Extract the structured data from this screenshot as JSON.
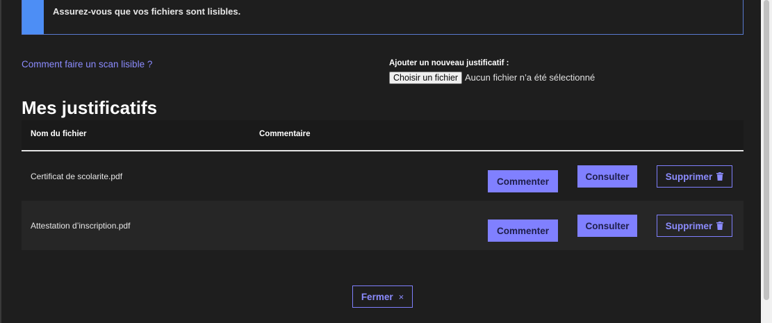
{
  "notice": {
    "text": "Assurez-vous que vos fichiers sont lisibles."
  },
  "help_link": {
    "label": "Comment faire un scan lisible ?"
  },
  "upload": {
    "label": "Ajouter un nouveau justificatif :",
    "button_label": "Choisir un fichier",
    "status": "Aucun fichier n’a été sélectionné"
  },
  "section": {
    "title": "Mes justificatifs"
  },
  "table": {
    "columns": {
      "filename": "Nom du fichier",
      "comment": "Commentaire"
    },
    "rows": [
      {
        "filename": "Certificat de scolarite.pdf",
        "comment_label": "Commenter",
        "view_label": "Consulter",
        "delete_label": "Supprimer"
      },
      {
        "filename": "Attestation d’inscription.pdf",
        "comment_label": "Commenter",
        "view_label": "Consulter",
        "delete_label": "Supprimer"
      }
    ]
  },
  "close": {
    "label": "Fermer",
    "icon": "×"
  },
  "colors": {
    "accent": "#8080ff",
    "info_bar": "#4d8ef5",
    "background": "#1e1e1e"
  }
}
